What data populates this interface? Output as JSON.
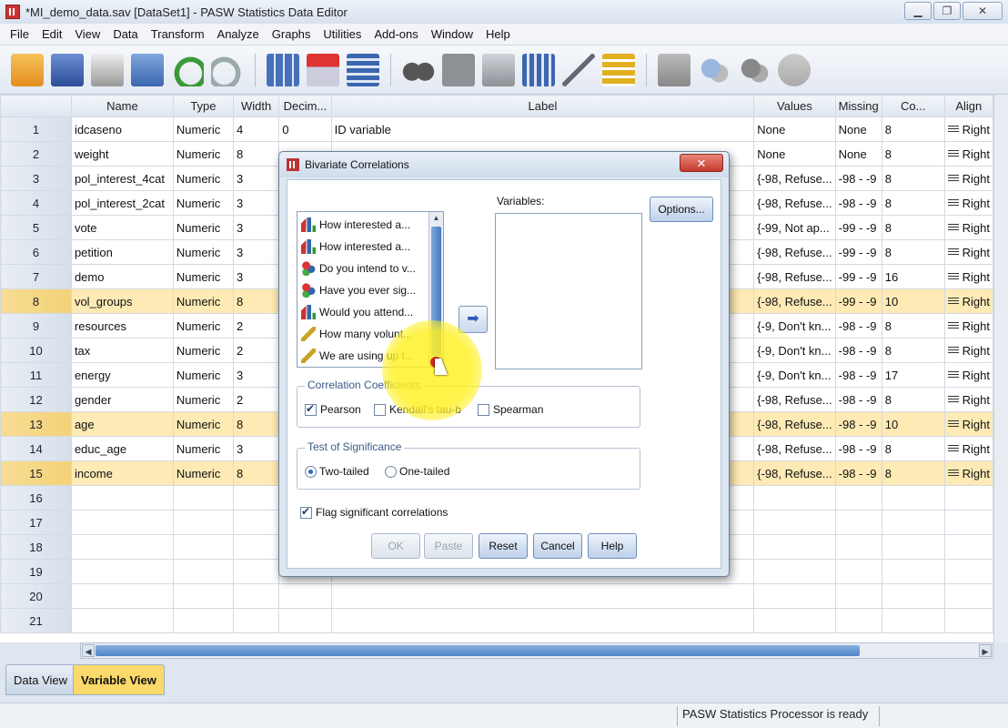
{
  "window": {
    "title": "*MI_demo_data.sav [DataSet1] - PASW Statistics Data Editor"
  },
  "menu": [
    "File",
    "Edit",
    "View",
    "Data",
    "Transform",
    "Analyze",
    "Graphs",
    "Utilities",
    "Add-ons",
    "Window",
    "Help"
  ],
  "grid": {
    "headers": [
      "Name",
      "Type",
      "Width",
      "Decim...",
      "Label",
      "Values",
      "Missing",
      "Co...",
      "Align"
    ],
    "rows": [
      {
        "num": "1",
        "name": "idcaseno",
        "type": "Numeric",
        "width": "4",
        "decimals": "0",
        "label": "ID variable",
        "values": "None",
        "missing": "None",
        "columns": "8",
        "align": "Right",
        "highlight": false
      },
      {
        "num": "2",
        "name": "weight",
        "type": "Numeric",
        "width": "8",
        "decimals": "",
        "label": "",
        "values": "None",
        "missing": "None",
        "columns": "8",
        "align": "Right",
        "highlight": false
      },
      {
        "num": "3",
        "name": "pol_interest_4cat",
        "type": "Numeric",
        "width": "3",
        "decimals": "",
        "label": "",
        "values": "{-98, Refuse...",
        "missing": "-98 - -9",
        "columns": "8",
        "align": "Right",
        "highlight": false
      },
      {
        "num": "4",
        "name": "pol_interest_2cat",
        "type": "Numeric",
        "width": "3",
        "decimals": "",
        "label": "",
        "values": "{-98, Refuse...",
        "missing": "-98 - -9",
        "columns": "8",
        "align": "Right",
        "highlight": false
      },
      {
        "num": "5",
        "name": "vote",
        "type": "Numeric",
        "width": "3",
        "decimals": "",
        "label": "",
        "values": "{-99, Not ap...",
        "missing": "-99 - -9",
        "columns": "8",
        "align": "Right",
        "highlight": false
      },
      {
        "num": "6",
        "name": "petition",
        "type": "Numeric",
        "width": "3",
        "decimals": "",
        "label": "",
        "values": "{-98, Refuse...",
        "missing": "-99 - -9",
        "columns": "8",
        "align": "Right",
        "highlight": false
      },
      {
        "num": "7",
        "name": "demo",
        "type": "Numeric",
        "width": "3",
        "decimals": "",
        "label": "",
        "values": "{-98, Refuse...",
        "missing": "-99 - -9",
        "columns": "16",
        "align": "Right",
        "highlight": false
      },
      {
        "num": "8",
        "name": "vol_groups",
        "type": "Numeric",
        "width": "8",
        "decimals": "",
        "label": "",
        "values": "{-98, Refuse...",
        "missing": "-99 - -9",
        "columns": "10",
        "align": "Right",
        "highlight": true
      },
      {
        "num": "9",
        "name": "resources",
        "type": "Numeric",
        "width": "2",
        "decimals": "",
        "label": "",
        "values": "{-9, Don't kn...",
        "missing": "-98 - -9",
        "columns": "8",
        "align": "Right",
        "highlight": false
      },
      {
        "num": "10",
        "name": "tax",
        "type": "Numeric",
        "width": "2",
        "decimals": "",
        "label": "",
        "values": "{-9, Don't kn...",
        "missing": "-98 - -9",
        "columns": "8",
        "align": "Right",
        "highlight": false
      },
      {
        "num": "11",
        "name": "energy",
        "type": "Numeric",
        "width": "3",
        "decimals": "",
        "label": "",
        "values": "{-9, Don't kn...",
        "missing": "-98 - -9",
        "columns": "17",
        "align": "Right",
        "highlight": false
      },
      {
        "num": "12",
        "name": "gender",
        "type": "Numeric",
        "width": "2",
        "decimals": "",
        "label": "",
        "values": "{-98, Refuse...",
        "missing": "-98 - -9",
        "columns": "8",
        "align": "Right",
        "highlight": false
      },
      {
        "num": "13",
        "name": "age",
        "type": "Numeric",
        "width": "8",
        "decimals": "",
        "label": "",
        "values": "{-98, Refuse...",
        "missing": "-98 - -9",
        "columns": "10",
        "align": "Right",
        "highlight": true
      },
      {
        "num": "14",
        "name": "educ_age",
        "type": "Numeric",
        "width": "3",
        "decimals": "",
        "label": "",
        "values": "{-98, Refuse...",
        "missing": "-98 - -9",
        "columns": "8",
        "align": "Right",
        "highlight": false
      },
      {
        "num": "15",
        "name": "income",
        "type": "Numeric",
        "width": "8",
        "decimals": "",
        "label": "",
        "values": "{-98, Refuse...",
        "missing": "-98 - -9",
        "columns": "8",
        "align": "Right",
        "highlight": true
      },
      {
        "num": "16",
        "name": "",
        "type": "",
        "width": "",
        "decimals": "",
        "label": "",
        "values": "",
        "missing": "",
        "columns": "",
        "align": "",
        "highlight": false
      },
      {
        "num": "17",
        "name": "",
        "type": "",
        "width": "",
        "decimals": "",
        "label": "",
        "values": "",
        "missing": "",
        "columns": "",
        "align": "",
        "highlight": false
      },
      {
        "num": "18",
        "name": "",
        "type": "",
        "width": "",
        "decimals": "",
        "label": "",
        "values": "",
        "missing": "",
        "columns": "",
        "align": "",
        "highlight": false
      },
      {
        "num": "19",
        "name": "",
        "type": "",
        "width": "",
        "decimals": "",
        "label": "",
        "values": "",
        "missing": "",
        "columns": "",
        "align": "",
        "highlight": false
      },
      {
        "num": "20",
        "name": "",
        "type": "",
        "width": "",
        "decimals": "",
        "label": "",
        "values": "",
        "missing": "",
        "columns": "",
        "align": "",
        "highlight": false
      },
      {
        "num": "21",
        "name": "",
        "type": "",
        "width": "",
        "decimals": "",
        "label": "",
        "values": "",
        "missing": "",
        "columns": "",
        "align": "",
        "highlight": false
      }
    ]
  },
  "tabs": {
    "data_view": "Data View",
    "variable_view": "Variable View"
  },
  "status": {
    "text": "PASW Statistics Processor is ready"
  },
  "dialog": {
    "title": "Bivariate Correlations",
    "close_label": "✕",
    "source_vars": [
      {
        "label": "How interested a...",
        "icon": "ordinal-icon"
      },
      {
        "label": "How interested a...",
        "icon": "ordinal-icon"
      },
      {
        "label": "Do you intend to v...",
        "icon": "nominal-icon"
      },
      {
        "label": "Have you ever sig...",
        "icon": "nominal-icon"
      },
      {
        "label": "Would you attend...",
        "icon": "ordinal-icon"
      },
      {
        "label": "How many volunt...",
        "icon": "scale-icon"
      },
      {
        "label": "We are using up t...",
        "icon": "scale-icon"
      }
    ],
    "variables_label": "Variables:",
    "options_button": "Options...",
    "move_arrow": "➡",
    "coefficients": {
      "legend": "Correlation Coefficients",
      "pearson": "Pearson",
      "kendall": "Kendall's tau-b",
      "spearman": "Spearman",
      "pearson_checked": true,
      "kendall_checked": false,
      "spearman_checked": false
    },
    "significance": {
      "legend": "Test of Significance",
      "two_tailed": "Two-tailed",
      "one_tailed": "One-tailed",
      "selected": "two-tailed"
    },
    "flag_label": "Flag significant correlations",
    "flag_checked": true,
    "buttons": {
      "ok": "OK",
      "paste": "Paste",
      "reset": "Reset",
      "cancel": "Cancel",
      "help": "Help"
    }
  },
  "colors": {
    "highlight_row": "#fdeab5",
    "active_tab": "#fbd96a",
    "accent": "#4f82c8"
  }
}
